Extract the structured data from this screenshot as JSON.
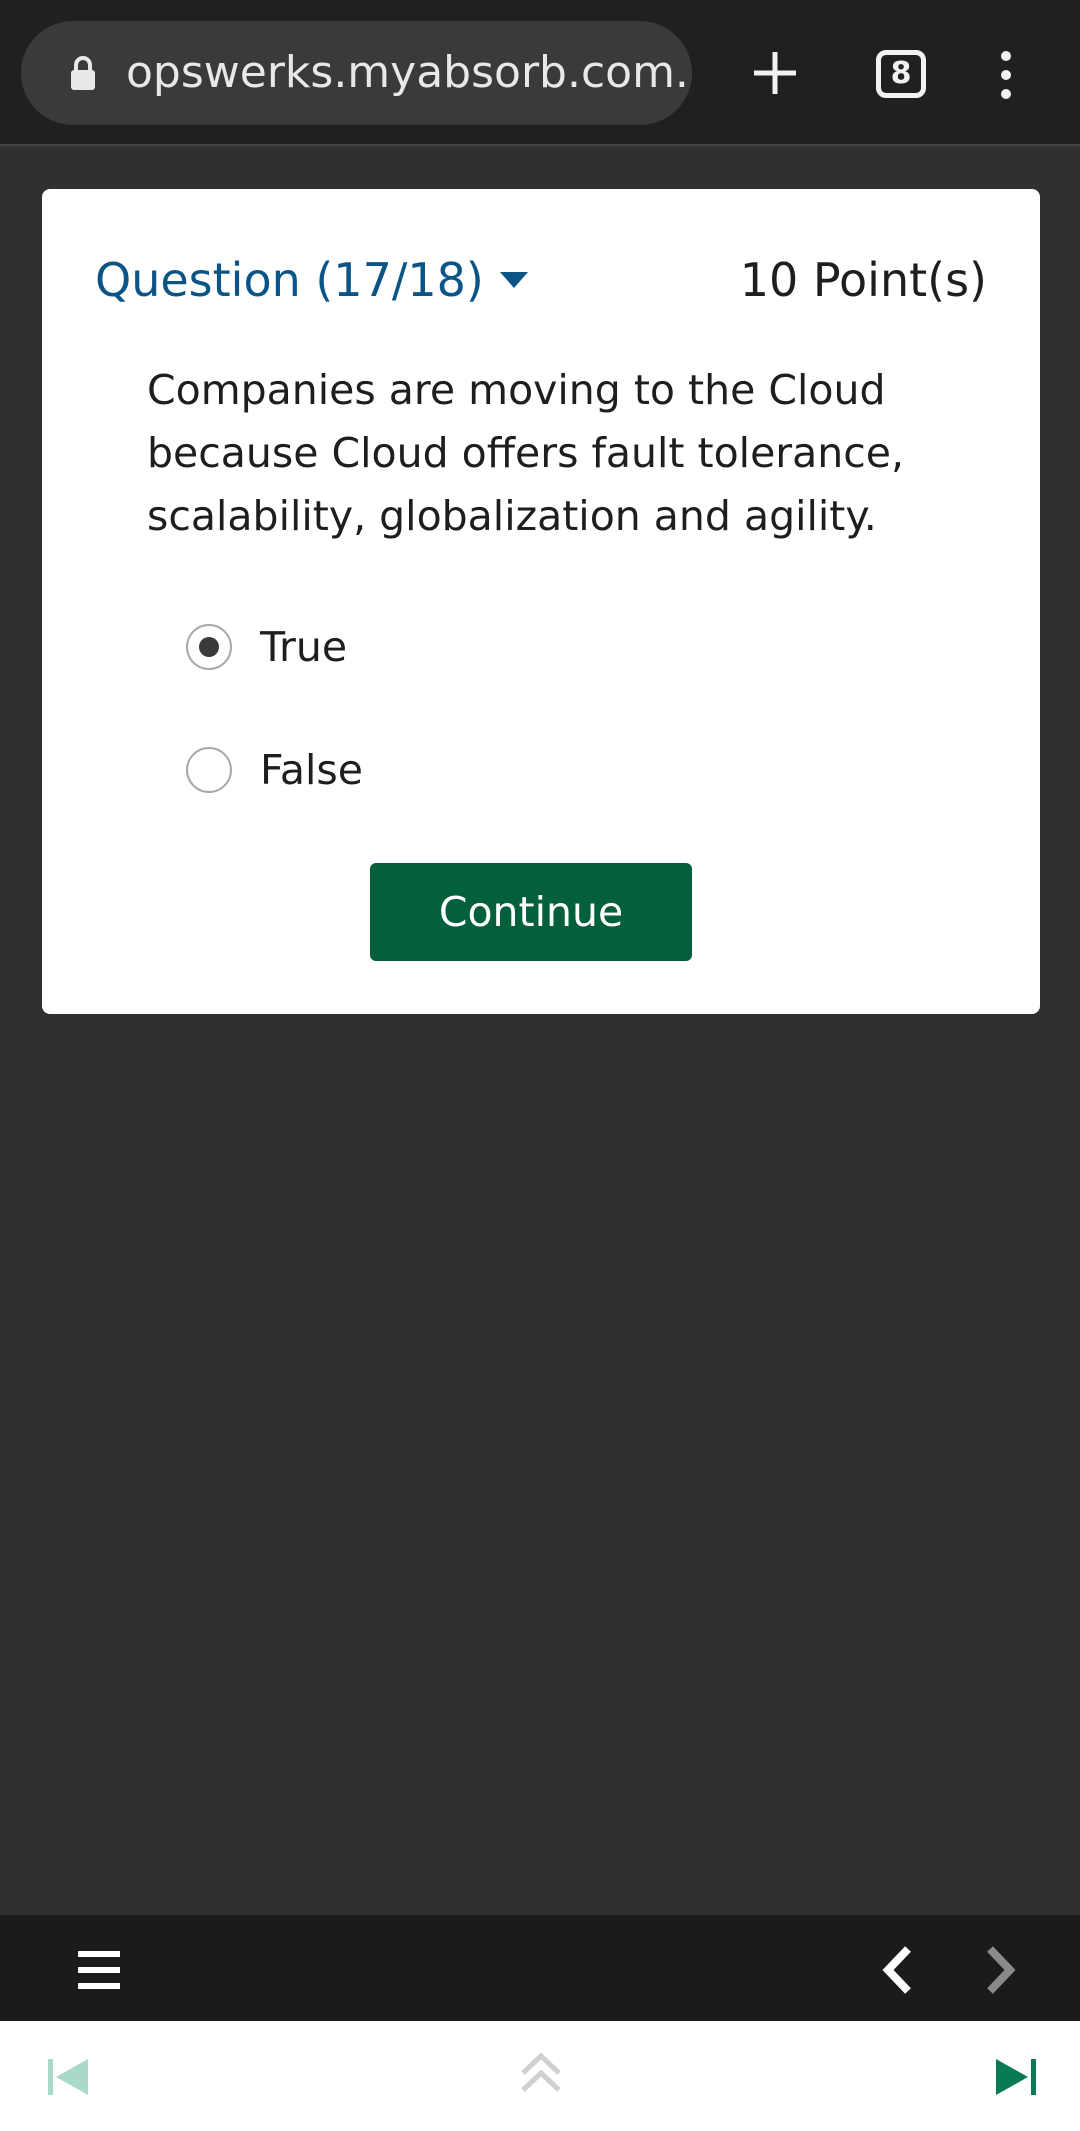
{
  "browser": {
    "url": "opswerks.myabsorb.com.au",
    "tab_count": "8",
    "icons": [
      "lock-icon",
      "plus-icon",
      "tabs-icon",
      "menu-dots-icon"
    ]
  },
  "question": {
    "header": "Question (17/18)",
    "points": "10 Point(s)",
    "text": "Companies are moving to the Cloud because Cloud offers fault tolerance, scalability, globalization and agility.",
    "options": [
      {
        "label": "True",
        "selected": true
      },
      {
        "label": "False",
        "selected": false
      }
    ],
    "continue_label": "Continue"
  },
  "colors": {
    "accent_blue": "#0b5486",
    "continue_green": "#045f3d",
    "page_background": "#303030"
  },
  "bottom_nav": {
    "icons": [
      "hamburger-icon",
      "chevron-left-icon",
      "chevron-right-icon"
    ]
  },
  "bottom_bar": {
    "icons": [
      "skip-back-icon",
      "double-chevron-up-icon",
      "skip-forward-icon"
    ]
  }
}
